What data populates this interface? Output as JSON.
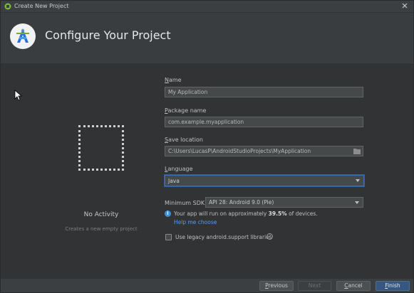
{
  "window": {
    "title": "Create New Project"
  },
  "header": {
    "title": "Configure Your Project"
  },
  "activity": {
    "name": "No Activity",
    "description": "Creates a new empty project"
  },
  "form": {
    "name": {
      "label_mnemonic": "N",
      "label_rest": "ame",
      "value": "My Application"
    },
    "package": {
      "label_mnemonic": "P",
      "label_rest": "ackage name",
      "value": "com.example.myapplication"
    },
    "save_location": {
      "label_mnemonic": "S",
      "label_rest": "ave location",
      "value": "C:\\Users\\LucasP\\AndroidStudioProjects\\MyApplication"
    },
    "language": {
      "label_mnemonic": "L",
      "label_rest": "anguage",
      "value": "Java"
    },
    "min_sdk": {
      "label": "Minimum SDK",
      "value": "API 28: Android 9.0 (Pie)"
    },
    "info": {
      "prefix": "Your app will run on approximately ",
      "percent": "39.5%",
      "suffix": " of devices."
    },
    "help_link": "Help me choose",
    "legacy": {
      "label": "Use legacy android.support libraries",
      "checked": false
    }
  },
  "footer": {
    "previous": {
      "mnemonic": "P",
      "rest": "revious"
    },
    "next": "Next",
    "cancel": {
      "mnemonic": "C",
      "rest": "ancel"
    },
    "finish": {
      "mnemonic": "F",
      "rest": "inish"
    }
  },
  "colors": {
    "accent": "#365880",
    "link": "#589df6",
    "info": "#3f8ed8",
    "background": "#313335"
  },
  "icons": [
    "android-studio-icon",
    "close-icon",
    "android-studio-logo-icon",
    "folder-icon",
    "chevron-down-icon",
    "info-icon",
    "question-icon",
    "mouse-cursor-icon"
  ]
}
